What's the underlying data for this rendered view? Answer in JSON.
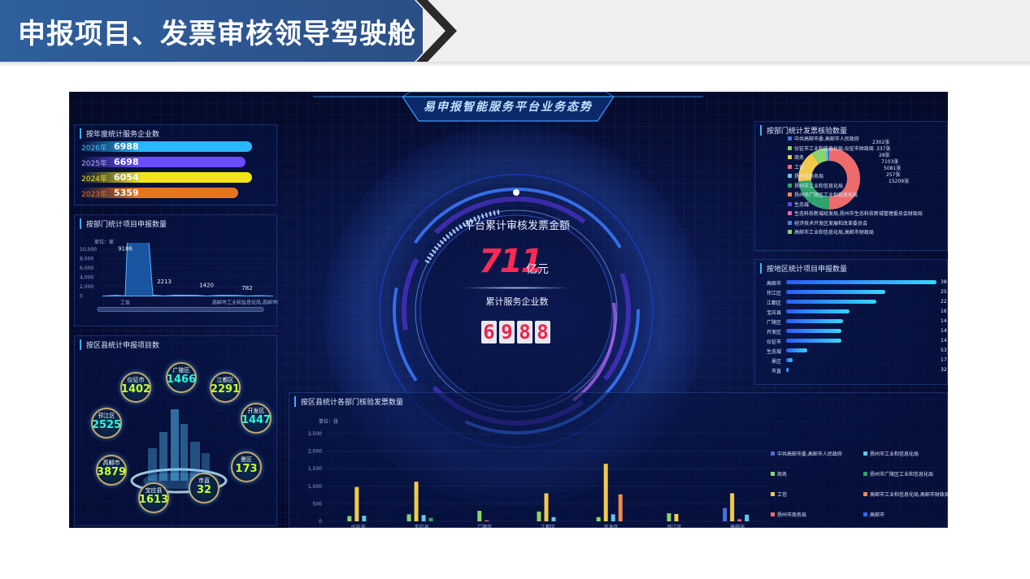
{
  "slide": {
    "title": "申报项目、发票审核领导驾驶舱"
  },
  "dashboard": {
    "title": "易申报智能服务平台业务态势",
    "center": {
      "label_amount": "平台累计审核发票金额",
      "amount_value": "711",
      "amount_unit": "亿元",
      "label_companies": "累计服务企业数",
      "companies_digits": [
        "6",
        "9",
        "8",
        "8"
      ]
    },
    "panels": {
      "year": {
        "title": "按年度统计服务企业数",
        "rows": [
          {
            "year": "2026年",
            "value": "6988",
            "color": "#2bb7ff",
            "label_color": "#49c2ff",
            "fill": 1.0
          },
          {
            "year": "2025年",
            "value": "6698",
            "color": "#6b4cff",
            "label_color": "#b8a8ff",
            "fill": 0.96
          },
          {
            "year": "2024年",
            "value": "6054",
            "color": "#f2e31b",
            "label_color": "#f2e31b",
            "fill": 1.0
          },
          {
            "year": "2023年",
            "value": "5359",
            "color": "#e8741c",
            "label_color": "#e8741c",
            "fill": 0.92
          }
        ]
      },
      "dept_projects": {
        "title": "按部门统计项目申报数量",
        "unit": "单位：家",
        "ylabels": [
          "10,000",
          "8,000",
          "6,000",
          "4,000",
          "2,000",
          "0"
        ],
        "peaks": [
          "9186",
          "2213",
          "1420",
          "782"
        ],
        "xlabels": [
          "工信",
          "高邮市工业和信息化局,高邮市财"
        ]
      },
      "county_projects": {
        "title": "按区县统计申报项目数",
        "bubbles": [
          {
            "name": "仪征市",
            "value": "1402",
            "color": "#c8ff2e"
          },
          {
            "name": "广陵区",
            "value": "1466",
            "color": "#2ef5d8"
          },
          {
            "name": "江都区",
            "value": "2291",
            "color": "#c8ff2e"
          },
          {
            "name": "邗江区",
            "value": "2525",
            "color": "#2ef5d8"
          },
          {
            "name": "开发区",
            "value": "1447",
            "color": "#2ef5d8"
          },
          {
            "name": "高邮市",
            "value": "3879",
            "color": "#c8ff2e"
          },
          {
            "name": "景区",
            "value": "173",
            "color": "#c8ff2e"
          },
          {
            "name": "市直",
            "value": "32",
            "color": "#c8ff2e"
          },
          {
            "name": "宝应县",
            "value": "1613",
            "color": "#c8ff2e"
          }
        ]
      },
      "dept_invoices": {
        "title": "按部门统计发票核验数量",
        "legend": [
          {
            "label": "中共高邮市委,高邮市人民政府",
            "color": "#4a6fd8"
          },
          {
            "label": "仪征市工业和信息化局,仪征市财政局",
            "color": "#8bd36a"
          },
          {
            "label": "商务",
            "color": "#f2c94c"
          },
          {
            "label": "工信",
            "color": "#ee6b6b"
          },
          {
            "label": "扬州市商务局",
            "color": "#5ec9e8"
          },
          {
            "label": "扬州市工业和信息化局",
            "color": "#2fa36b"
          },
          {
            "label": "扬州市广陵区工业和信息化局",
            "color": "#f08a4b"
          },
          {
            "label": "生态城",
            "color": "#6a4ad8"
          },
          {
            "label": "生态科技新城经发局,扬州市生态科技新城管理委员会财政局",
            "color": "#e46aa8"
          },
          {
            "label": "经济技术开发区发展和改革委员会",
            "color": "#3a8ad8"
          },
          {
            "label": "高邮市工业和信息化局,高邮市财政局",
            "color": "#8bd36a"
          }
        ],
        "callouts": [
          "2302张",
          "337张",
          "28张",
          "7103张",
          "5081张",
          "257张",
          "15209张"
        ],
        "slices": [
          {
            "value": 15209,
            "color": "#ee6b6b"
          },
          {
            "value": 7103,
            "color": "#2fa36b"
          },
          {
            "value": 5081,
            "color": "#f2c94c"
          },
          {
            "value": 2302,
            "color": "#8bd36a"
          },
          {
            "value": 337,
            "color": "#5ec9e8"
          },
          {
            "value": 257,
            "color": "#4a6fd8"
          },
          {
            "value": 28,
            "color": "#f08a4b"
          }
        ]
      },
      "region_projects": {
        "title": "按地区统计项目申报数量",
        "rows": [
          {
            "name": "高邮市",
            "value": "38",
            "fill": 1.0
          },
          {
            "name": "邗江区",
            "value": "25",
            "fill": 0.66
          },
          {
            "name": "江都区",
            "value": "22",
            "fill": 0.6
          },
          {
            "name": "宝应县",
            "value": "16",
            "fill": 0.42
          },
          {
            "name": "广陵区",
            "value": "14",
            "fill": 0.38
          },
          {
            "name": "开发区",
            "value": "14",
            "fill": 0.37
          },
          {
            "name": "仪征市",
            "value": "14",
            "fill": 0.37
          },
          {
            "name": "生态城",
            "value": "53",
            "fill": 0.14
          },
          {
            "name": "景区",
            "value": "17",
            "fill": 0.045
          },
          {
            "name": "市直",
            "value": "32",
            "fill": 0.01
          }
        ]
      },
      "county_invoices": {
        "title": "按区县统计各部门核验发票数量",
        "unit": "单位：张",
        "legend_left": [
          "中共高邮市委,高邮市人民政府",
          "商务",
          "工信",
          "扬州市商务局"
        ],
        "legend_right": [
          "扬州市工业和信息化局",
          "扬州市广陵区工业和信息化局",
          "高邮市工业和信息化局,高邮市财政局",
          "高邮市"
        ]
      }
    }
  },
  "chart_data": {
    "type": "bar",
    "title": "按区县统计各部门核验发票数量",
    "ylabel": "单位：张",
    "ylim": [
      0,
      2500
    ],
    "yticks": [
      "2,500",
      "2,000",
      "1,500",
      "1,000",
      "500",
      "0"
    ],
    "categories": [
      "仪征市",
      "宝应县",
      "广陵区",
      "江都区",
      "开发区",
      "邗江区",
      "高邮市"
    ],
    "series": [
      {
        "name": "中共高邮市委,高邮市人民政府",
        "color": "#4a6fd8",
        "values": [
          0,
          0,
          0,
          0,
          0,
          0,
          380
        ]
      },
      {
        "name": "商务",
        "color": "#8bd36a",
        "values": [
          150,
          200,
          300,
          280,
          120,
          230,
          0
        ]
      },
      {
        "name": "工信",
        "color": "#f2c94c",
        "values": [
          980,
          1130,
          0,
          800,
          1640,
          210,
          800
        ]
      },
      {
        "name": "扬州市商务局",
        "color": "#ee6b6b",
        "values": [
          0,
          0,
          30,
          0,
          0,
          0,
          60
        ]
      },
      {
        "name": "扬州市工业和信息化局",
        "color": "#5ec9e8",
        "values": [
          160,
          180,
          0,
          120,
          200,
          0,
          190
        ]
      },
      {
        "name": "扬州市广陵区工业和信息化局",
        "color": "#2fa36b",
        "values": [
          0,
          100,
          0,
          0,
          0,
          0,
          0
        ]
      },
      {
        "name": "高邮市工业和信息化局,高邮市财政局",
        "color": "#f08a4b",
        "values": [
          0,
          0,
          0,
          0,
          770,
          0,
          0
        ]
      }
    ]
  }
}
